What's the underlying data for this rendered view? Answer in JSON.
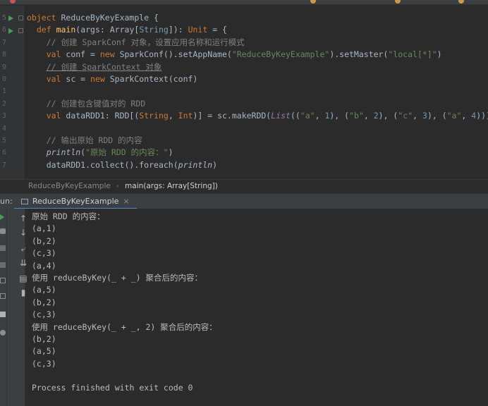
{
  "editor": {
    "line_numbers": [
      "5",
      "6",
      "7",
      "8",
      "9",
      "0",
      "1",
      "2",
      "3",
      "4",
      "5",
      "6",
      "7"
    ],
    "code": {
      "l1": {
        "kw": "object",
        "name": "ReduceByKeyExample",
        "rest": " {"
      },
      "l2": {
        "kw": "def",
        "name": "main",
        "p1": "(args: ",
        "t1": "Array",
        "p2": "[",
        "t2": "String",
        "p3": "]): ",
        "t3": "Unit",
        "p4": " = {"
      },
      "l3": {
        "comment": "// 创建 SparkConf 对象，设置应用名称和运行模式"
      },
      "l4": {
        "kw": "val",
        "a": " conf = ",
        "kw2": "new",
        "b": " SparkConf().setAppName(",
        "s1": "\"ReduceByKeyExample\"",
        "c": ").setMaster(",
        "s2": "\"local[*]\"",
        "d": ")"
      },
      "l5": {
        "comment": "// 创建 SparkContext 对象"
      },
      "l6": {
        "kw": "val",
        "a": " sc = ",
        "kw2": "new",
        "b": " SparkContext(conf)"
      },
      "l7": {
        "text": ""
      },
      "l8": {
        "comment": "// 创建包含键值对的 RDD"
      },
      "l9": {
        "kw": "val",
        "a": " dataRDD1: RDD[(",
        "t1": "String",
        "b": ", ",
        "t2": "Int",
        "c": ")] = sc.makeRDD(",
        "list": "List",
        "d": "((",
        "s1": "\"a\"",
        "e1": ", ",
        "n1": "1",
        "f1": "), (",
        "s2": "\"b\"",
        "e2": ", ",
        "n2": "2",
        "f2": "), (",
        "s3": "\"c\"",
        "e3": ", ",
        "n3": "3",
        "f3": "), (",
        "s4": "\"a\"",
        "e4": ", ",
        "n4": "4",
        "f4": ")))"
      },
      "l10": {
        "text": ""
      },
      "l11": {
        "comment": "// 输出原始 RDD 的内容"
      },
      "l12": {
        "fn": "println",
        "a": "(",
        "s": "\"原始 RDD 的内容：\"",
        "b": ")"
      },
      "l13": {
        "a": "dataRDD1.collect().foreach(",
        "fn": "println",
        "b": ")"
      }
    }
  },
  "breadcrumb": {
    "object": "ReduceByKeyExample",
    "method": "main(args: Array[String])"
  },
  "run_panel": {
    "label": "un:",
    "tab": "ReduceByKeyExample",
    "close": "×"
  },
  "console": {
    "lines": [
      "原始 RDD 的内容：",
      "(a,1)",
      "(b,2)",
      "(c,3)",
      "(a,4)",
      "使用 reduceByKey(_ + _) 聚合后的内容：",
      "(a,5)",
      "(b,2)",
      "(c,3)",
      "使用 reduceByKey(_ + _, 2) 聚合后的内容：",
      "(b,2)",
      "(a,5)",
      "(c,3)",
      "",
      "Process finished with exit code 0"
    ]
  },
  "toolbar_icons": [
    "rerun-icon",
    "up-arrow-icon",
    "down-arrow-icon",
    "soft-wrap-icon",
    "scroll-to-end-icon",
    "print-icon",
    "trash-icon"
  ],
  "colors": {
    "keyword": "#cc7832",
    "string": "#6a8759",
    "number": "#6897bb",
    "comment": "#808080",
    "function": "#ffc66d",
    "tab_underline": "#4a88c7"
  }
}
